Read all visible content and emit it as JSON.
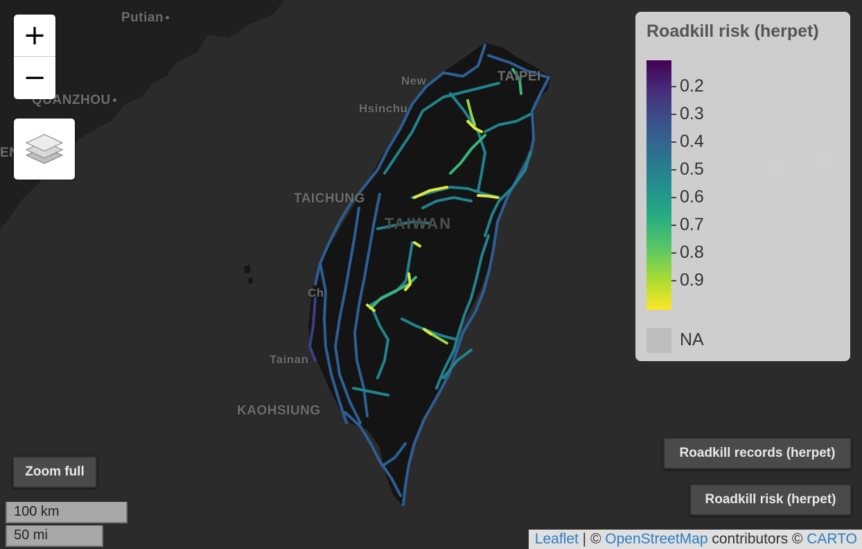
{
  "map": {
    "place_labels": {
      "putian": "Putian",
      "quanzhou": "QUANZHOU",
      "taichung": "TAICHUNG",
      "hsinchu": "Hsinchu",
      "new_taipei": "New",
      "taipei": "TAIPEI",
      "taiwan": "TAIWAN",
      "chiayi": "Ch",
      "tainan": "Tainan",
      "kaohsiung": "KAOHSIUNG",
      "edge_fragment": "EN"
    },
    "colors": {
      "sea": "#2b2b2b",
      "land": "#141414",
      "china_land": "#1f1f1f"
    }
  },
  "controls": {
    "zoom_in": "+",
    "zoom_out": "−",
    "zoom_full": "Zoom full",
    "layer_records": "Roadkill records (herpet)",
    "layer_risk": "Roadkill risk (herpet)"
  },
  "legend": {
    "title": "Roadkill risk (herpet)",
    "ticks": [
      "0.2",
      "0.3",
      "0.4",
      "0.5",
      "0.6",
      "0.7",
      "0.8",
      "0.9"
    ],
    "na_label": "NA",
    "palette": "viridis"
  },
  "scale": {
    "km": "100 km",
    "mi": "50 mi"
  },
  "attribution": {
    "leaflet": "Leaflet",
    "sep1": " | © ",
    "osm": "OpenStreetMap",
    "contributors": " contributors © ",
    "carto": "CARTO"
  }
}
